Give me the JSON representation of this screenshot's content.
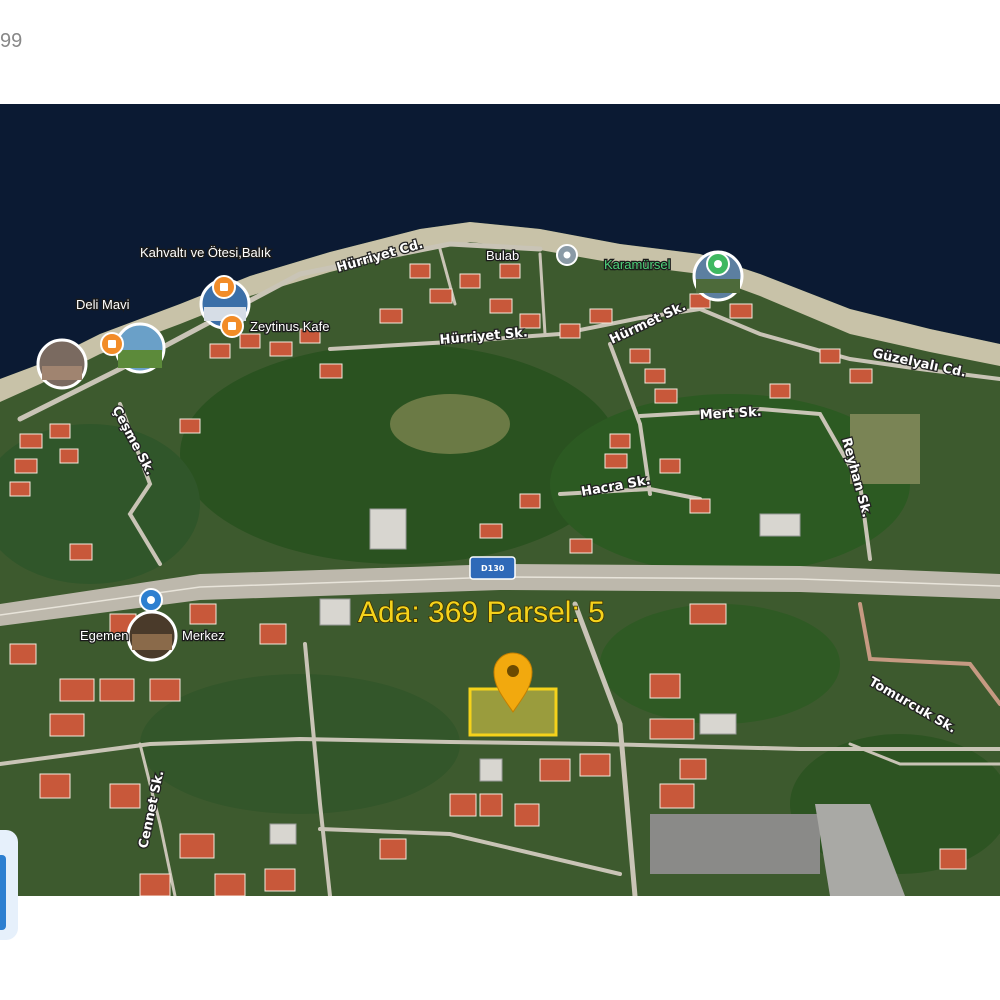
{
  "corner_text": "99",
  "parcel": {
    "label": "Ada: 369  Parsel: 5"
  },
  "highway": {
    "label": "D130"
  },
  "streets": {
    "hurriyet_cd": "Hürriyet Cd.",
    "hurriyet_sk": "Hürriyet Sk.",
    "hurmet_sk": "Hürmet Sk.",
    "guzelyali_cd": "Güzelyalı Cd.",
    "mert_sk": "Mert Sk.",
    "reyhan_sk": "Reyhan Sk.",
    "cesme_sk": "Çeşme Sk.",
    "hacra_sk": "Hacra Sk.",
    "cennet_sk": "Cennet Sk.",
    "tomurcuk_sk": "Tomurcuk Sk."
  },
  "pois": {
    "kahvalti": "Kahvaltı ve Ötesi,Balık",
    "deli_mavi": "Deli Mavi",
    "zeytinus": "Zeytinus Kafe",
    "bulab": "Bulab",
    "karamursel": "Karamürsel",
    "egemen": "Egemen",
    "merkez": "Merkez"
  },
  "colors": {
    "sea": "#0b1a33",
    "vegetation": "#2f5a24",
    "road": "#bdb8ac",
    "parcel_fill": "#e8d34a",
    "marker": "#f2a90e",
    "poi_orange": "#f28c28",
    "poi_blue": "#2d7fd0",
    "poi_green": "#3fb861"
  }
}
